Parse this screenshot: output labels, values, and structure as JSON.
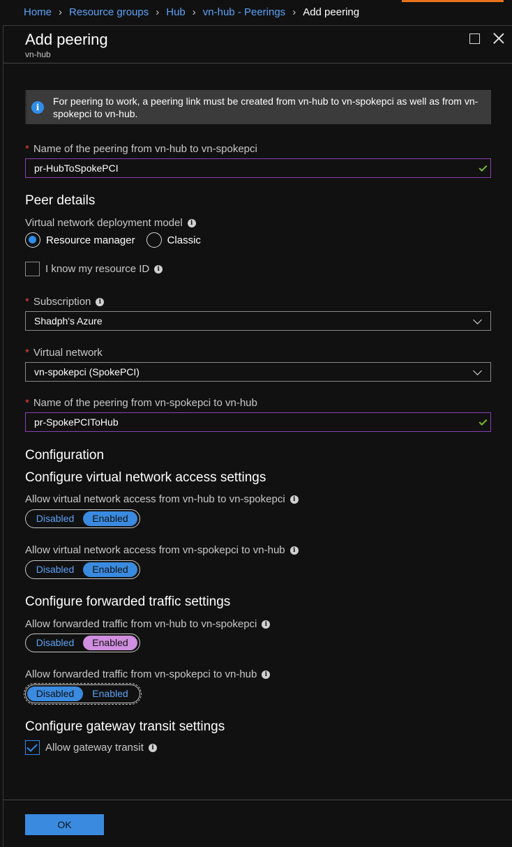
{
  "breadcrumb": {
    "items": [
      "Home",
      "Resource groups",
      "Hub",
      "vn-hub - Peerings"
    ],
    "current": "Add peering"
  },
  "blade": {
    "title": "Add peering",
    "subtitle": "vn-hub"
  },
  "info": {
    "text": "For peering to work, a peering link must be created from vn-hub to vn-spokepci as well as from vn-spokepci to vn-hub."
  },
  "peering_name": {
    "label": "Name of the peering from vn-hub to vn-spokepci",
    "value": "pr-HubToSpokePCI"
  },
  "peer_details": {
    "heading": "Peer details",
    "deployment_label": "Virtual network deployment model",
    "options": [
      "Resource manager",
      "Classic"
    ],
    "selected": "Resource manager",
    "resource_id_label": "I know my resource ID",
    "resource_id_checked": false
  },
  "subscription": {
    "label": "Subscription",
    "value": "Shadph's Azure"
  },
  "virtual_network": {
    "label": "Virtual network",
    "value": "vn-spokepci (SpokePCI)"
  },
  "reverse_peering_name": {
    "label": "Name of the peering from vn-spokepci to vn-hub",
    "value": "pr-SpokePCIToHub"
  },
  "configuration": {
    "heading": "Configuration",
    "vnet_access_heading": "Configure virtual network access settings",
    "access_hub_to_spoke": {
      "label": "Allow virtual network access from vn-hub to vn-spokepci",
      "selected": "Enabled"
    },
    "access_spoke_to_hub": {
      "label": "Allow virtual network access from vn-spokepci to vn-hub",
      "selected": "Enabled"
    },
    "forwarded_heading": "Configure forwarded traffic settings",
    "forward_hub_to_spoke": {
      "label": "Allow forwarded traffic from vn-hub to vn-spokepci",
      "selected": "Enabled"
    },
    "forward_spoke_to_hub": {
      "label": "Allow forwarded traffic from vn-spokepci to vn-hub",
      "selected": "Disabled"
    },
    "toggle_disabled_label": "Disabled",
    "toggle_enabled_label": "Enabled",
    "gateway_heading": "Configure gateway transit settings",
    "gateway_label": "Allow gateway transit",
    "gateway_checked": true
  },
  "ok_label": "OK",
  "colors": {
    "accent_blue": "#3a8be0",
    "link_blue": "#5aa3f7",
    "focus_purple": "#8a3fb5",
    "toggle_purple": "#d08fe0",
    "valid_green": "#7cbb2e",
    "required_red": "#e83f3f"
  }
}
